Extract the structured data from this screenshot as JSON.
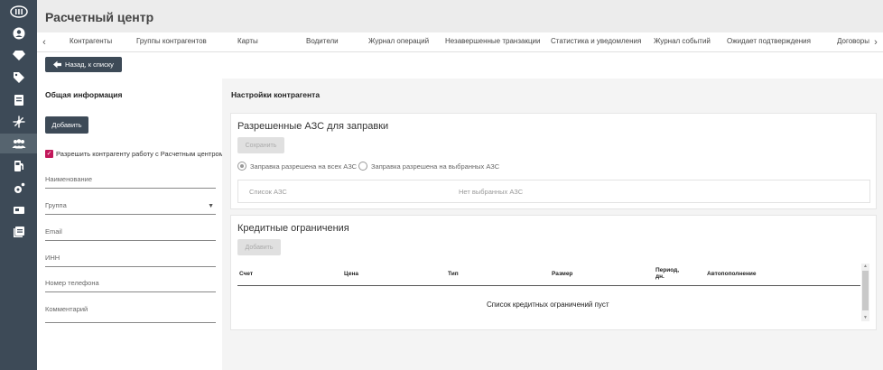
{
  "app": {
    "title": "Расчетный центр"
  },
  "sidebar": {
    "icons": [
      {
        "name": "logo-icon"
      },
      {
        "name": "user-icon"
      },
      {
        "name": "diamond-icon"
      },
      {
        "name": "tag-icon"
      },
      {
        "name": "document-icon"
      },
      {
        "name": "network-icon"
      },
      {
        "name": "users-icon",
        "active": true
      },
      {
        "name": "fuel-pump-icon"
      },
      {
        "name": "gear-user-icon"
      },
      {
        "name": "card-icon"
      },
      {
        "name": "library-icon"
      }
    ]
  },
  "tabs": [
    "Контрагенты",
    "Группы контрагентов",
    "Карты",
    "Водители",
    "Журнал операций",
    "Незавершенные транзакции",
    "Статистика и уведомления",
    "Журнал событий",
    "Ожидает подтверждения",
    "Договоры"
  ],
  "back_button": {
    "label": "Назад, к списку"
  },
  "general": {
    "title": "Общая информация",
    "add_label": "Добавить",
    "checkbox_label": "Разрешить контрагенту работу с Расчетным центром",
    "checkbox_checked": true,
    "fields": {
      "name": "Наименование",
      "group": "Группа",
      "email": "Email",
      "inn": "ИНН",
      "phone": "Номер телефона",
      "comment": "Комментарий"
    }
  },
  "settings": {
    "title": "Настройки контрагента",
    "stations": {
      "title": "Разрешенные АЗС для заправки",
      "save_label": "Сохранить",
      "radio_all": "Заправка разрешена на всех АЗС",
      "radio_selected": "Заправка разрешена на выбранных АЗС",
      "list_label": "Список АЗС",
      "none_selected": "Нет выбранных АЗС"
    },
    "credit": {
      "title": "Кредитные ограничения",
      "add_label": "Добавить",
      "columns": [
        "Счет",
        "Цена",
        "Тип",
        "Размер",
        "Период, дн.",
        "Автопополнение"
      ],
      "empty": "Список кредитных ограничений пуст"
    }
  },
  "colors": {
    "sidebar": "#3d4a57",
    "accent": "#c2185b"
  }
}
